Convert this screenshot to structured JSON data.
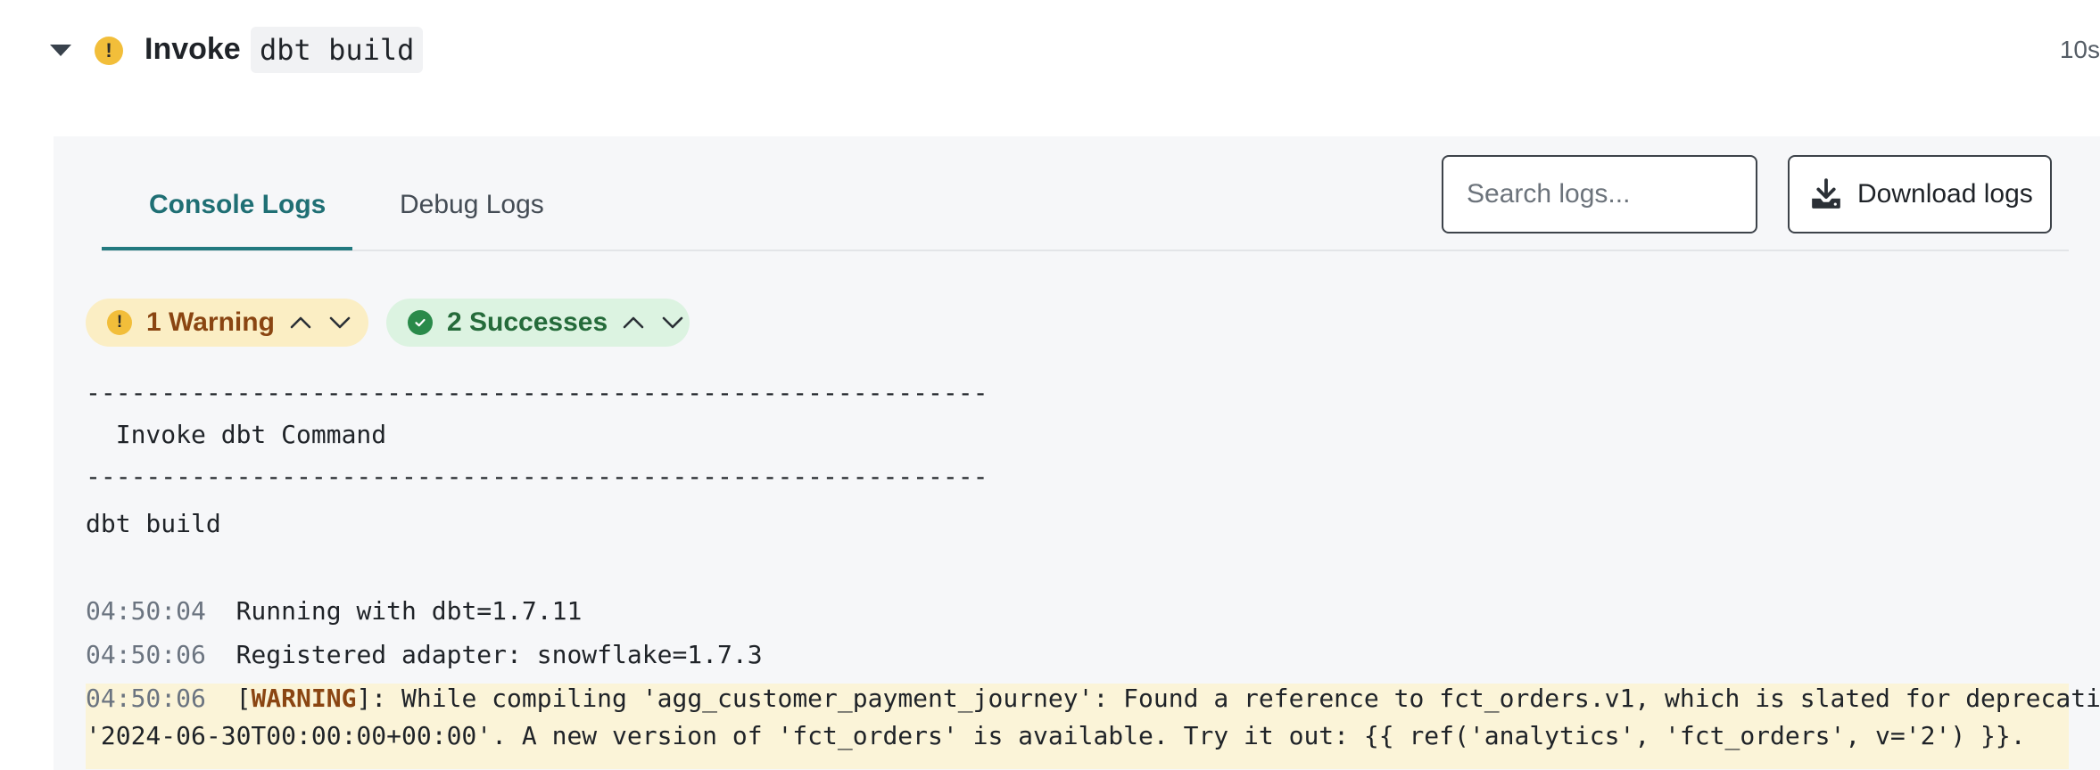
{
  "step": {
    "warning_glyph": "!",
    "title": "Invoke",
    "command": "dbt build",
    "duration": "10s"
  },
  "tabs": {
    "console": "Console Logs",
    "debug": "Debug Logs"
  },
  "search": {
    "placeholder": "Search logs..."
  },
  "download": {
    "label": "Download logs",
    "icon": "download-icon"
  },
  "filters": {
    "warning": {
      "label": "1 Warning",
      "icon": "warning-icon"
    },
    "success": {
      "label": "2 Successes",
      "icon": "check-circle-icon"
    }
  },
  "log": {
    "separator": "------------------------------------------------------------",
    "heading": "  Invoke dbt Command",
    "command": "dbt build",
    "lines": [
      {
        "time": "04:50:04",
        "text": "Running with dbt=1.7.11"
      },
      {
        "time": "04:50:06",
        "text": "Registered adapter: snowflake=1.7.3"
      }
    ],
    "warning": {
      "time": "04:50:06",
      "open": "[",
      "tag": "WARNING",
      "close_and_text": "]: While compiling 'agg_customer_payment_journey': Found a reference to fct_orders.v1, which is slated for deprecation on",
      "continuation": "'2024-06-30T00:00:00+00:00'. A new version of 'fct_orders' is available. Try it out: {{ ref('analytics', 'fct_orders', v='2') }}."
    }
  },
  "colors": {
    "accent": "#237a80",
    "warning": "#f2be3a",
    "warning_text": "#8a4512",
    "success": "#2a8a4a",
    "warning_row_bg": "#fbf4d8"
  }
}
